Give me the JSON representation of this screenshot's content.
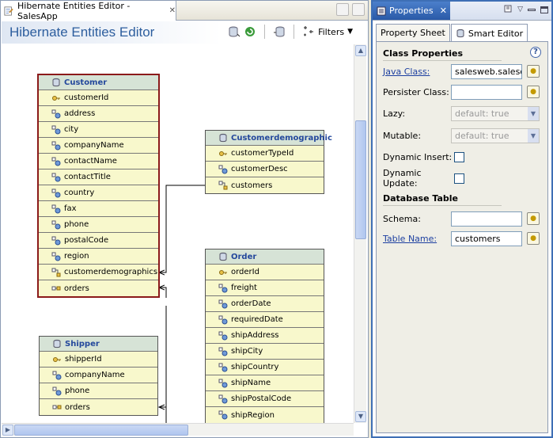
{
  "editor": {
    "tab_title": "Hibernate Entities Editor - SalesApp",
    "heading": "Hibernate Entities Editor",
    "filters_label": "Filters"
  },
  "entities": {
    "customer": {
      "name": "Customer",
      "fields": [
        "customerId",
        "address",
        "city",
        "companyName",
        "contactName",
        "contactTitle",
        "country",
        "fax",
        "phone",
        "postalCode",
        "region",
        "customerdemographics",
        "orders"
      ]
    },
    "customerdemographic": {
      "name": "Customerdemographic",
      "fields": [
        "customerTypeId",
        "customerDesc",
        "customers"
      ]
    },
    "order": {
      "name": "Order",
      "fields": [
        "orderId",
        "freight",
        "orderDate",
        "requiredDate",
        "shipAddress",
        "shipCity",
        "shipCountry",
        "shipName",
        "shipPostalCode",
        "shipRegion"
      ]
    },
    "shipper": {
      "name": "Shipper",
      "fields": [
        "shipperId",
        "companyName",
        "phone",
        "orders"
      ]
    }
  },
  "properties": {
    "view_title": "Properties",
    "tabs": [
      "Property Sheet",
      "Smart Editor"
    ],
    "class_section": "Class Properties",
    "java_class_label": "Java Class:",
    "java_class_value": "salesweb.salesdao",
    "persister_label": "Persister Class:",
    "persister_value": "",
    "lazy_label": "Lazy:",
    "lazy_value": "default: true",
    "mutable_label": "Mutable:",
    "mutable_value": "default: true",
    "dynamic_insert_label": "Dynamic Insert:",
    "dynamic_update_label": "Dynamic Update:",
    "db_section": "Database Table",
    "schema_label": "Schema:",
    "schema_value": "",
    "table_label": "Table Name:",
    "table_value": "customers"
  },
  "colors": {
    "entity_fill": "#f8f8cc",
    "entity_header": "#d6e3d6",
    "selected_border": "#8b1a1a",
    "title_blue": "#2d5e9e",
    "active_view": "#3e6fb5"
  }
}
